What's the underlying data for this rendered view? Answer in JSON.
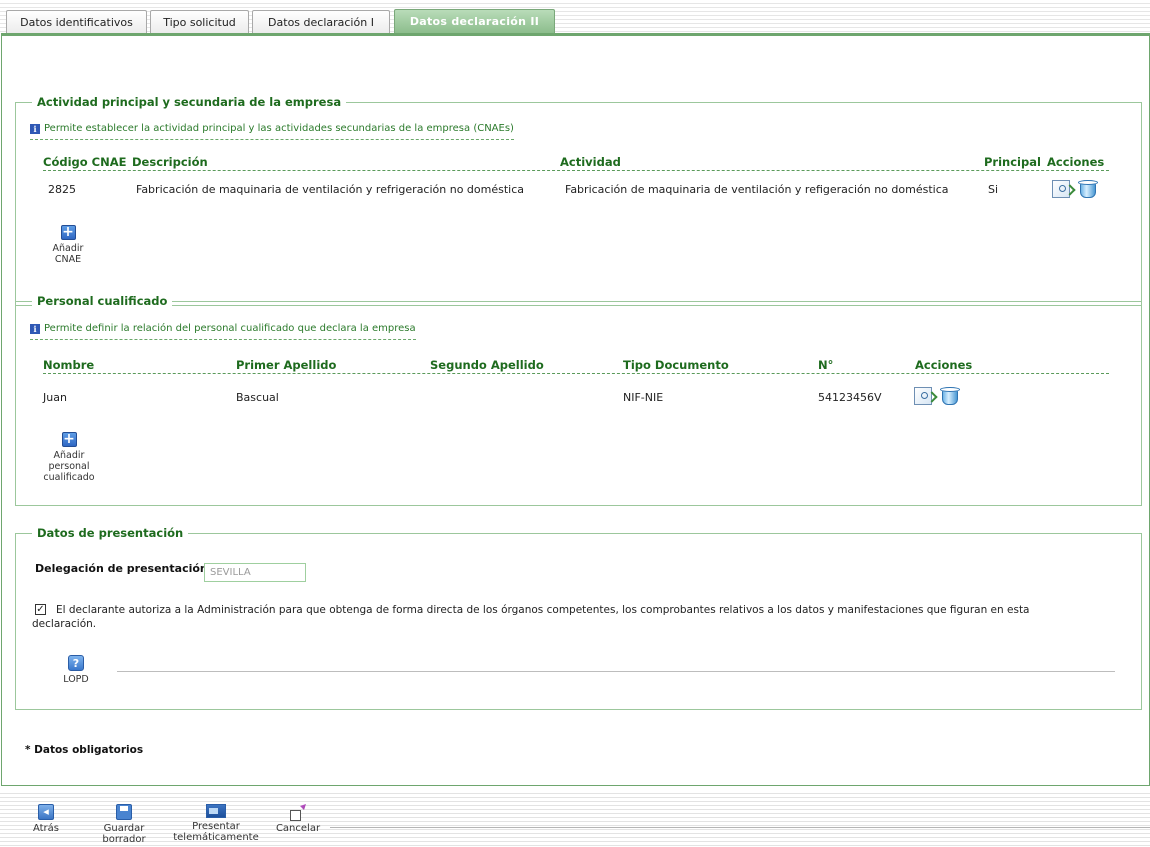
{
  "tabs": [
    {
      "label": "Datos identificativos",
      "active": false
    },
    {
      "label": "Tipo solicitud",
      "active": false
    },
    {
      "label": "Datos declaración I",
      "active": false
    },
    {
      "label": "Datos declaración II",
      "active": true
    }
  ],
  "actividad": {
    "legend": "Actividad principal y secundaria de la empresa",
    "info": "Permite establecer la actividad principal y las actividades secundarias de la empresa (CNAEs)",
    "columns": {
      "codigo": "Código CNAE",
      "descripcion": "Descripción",
      "actividad": "Actividad",
      "principal": "Principal",
      "acciones": "Acciones"
    },
    "rows": [
      {
        "codigo": "2825",
        "descripcion": "Fabricación de maquinaria de ventilación y refrigeración no doméstica",
        "actividad": "Fabricación de maquinaria de ventilación y refigeración no doméstica",
        "principal": "Si"
      }
    ],
    "add_label": "Añadir CNAE"
  },
  "personal": {
    "legend": "Personal cualificado",
    "info": "Permite definir la relación del personal cualificado que declara la empresa",
    "columns": {
      "nombre": "Nombre",
      "apellido1": "Primer Apellido",
      "apellido2": "Segundo Apellido",
      "tipo_doc": "Tipo Documento",
      "numero": "N°",
      "acciones": "Acciones"
    },
    "rows": [
      {
        "nombre": "Juan",
        "apellido1": "Bascual",
        "apellido2": "",
        "tipo_doc": "NIF-NIE",
        "numero": "54123456V"
      }
    ],
    "add_label_1": "Añadir",
    "add_label_2": "personal",
    "add_label_3": "cualificado"
  },
  "presentacion": {
    "legend": "Datos de presentación",
    "delegacion_label": "Delegación de presentación",
    "required_mark": "*",
    "delegacion_value": "SEVILLA",
    "autoriza_checked": true,
    "autoriza_line1": "El declarante autoriza a la Administración para que obtenga de forma directa de los órganos competentes, los comprobantes relativos a los datos y manifestaciones que figuran en esta",
    "autoriza_line2": "declaración.",
    "lopd_label": "LOPD"
  },
  "footer_note": "* Datos obligatorios",
  "toolbar": {
    "back": "Atrás",
    "save_1": "Guardar",
    "save_2": "borrador",
    "submit_1": "Presentar",
    "submit_2": "telemáticamente",
    "cancel": "Cancelar"
  },
  "icons": {
    "edit": "edit-search-icon",
    "delete": "trash-can-icon",
    "add": "plus-icon",
    "help": "help-question-icon",
    "info": "info-icon"
  },
  "colors": {
    "accent_green": "#1e6b1e",
    "active_tab": "#8cbd8c",
    "required": "#cc0000"
  }
}
